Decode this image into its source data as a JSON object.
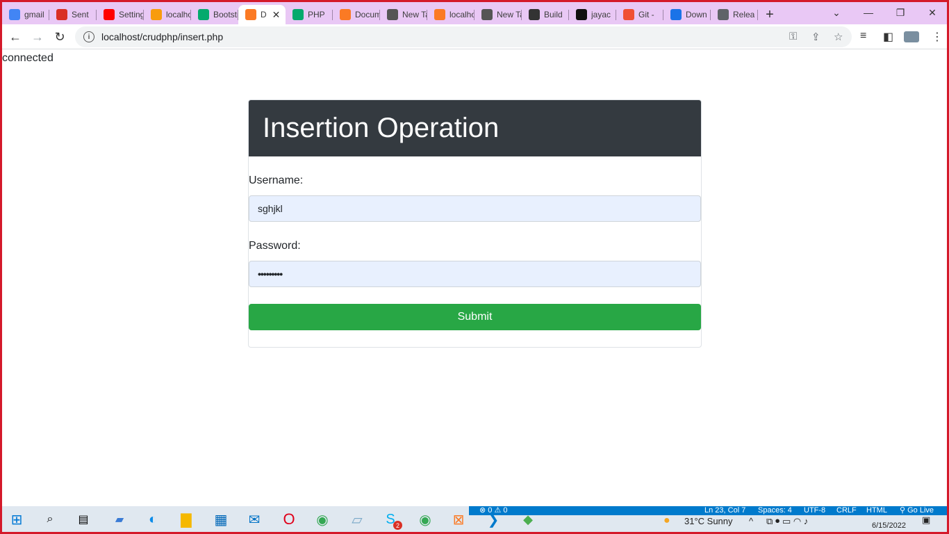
{
  "browser": {
    "tabs": [
      {
        "title": "gmail",
        "icon": "google-icon",
        "color": "#4285f4"
      },
      {
        "title": "Sent",
        "icon": "gmail-icon",
        "color": "#d93025"
      },
      {
        "title": "Settings",
        "icon": "youtube-icon",
        "color": "#ff0000"
      },
      {
        "title": "localhost",
        "icon": "phpmyadmin-icon",
        "color": "#f89c0e"
      },
      {
        "title": "Bootstrap",
        "icon": "w3schools-icon",
        "color": "#04aa6d"
      },
      {
        "title": "D",
        "icon": "xampp-icon",
        "color": "#fb7a24",
        "active": true
      },
      {
        "title": "PHP",
        "icon": "w3schools-icon",
        "color": "#04aa6d"
      },
      {
        "title": "Documentation",
        "icon": "xampp-icon",
        "color": "#fb7a24"
      },
      {
        "title": "New Tab",
        "icon": "chrome-icon",
        "color": "#555555"
      },
      {
        "title": "localhost",
        "icon": "xampp-icon",
        "color": "#fb7a24"
      },
      {
        "title": "New Tab",
        "icon": "chrome-icon",
        "color": "#555555"
      },
      {
        "title": "Build",
        "icon": "code-icon",
        "color": "#333333"
      },
      {
        "title": "jayac",
        "icon": "github-icon",
        "color": "#111111"
      },
      {
        "title": "Git -",
        "icon": "git-icon",
        "color": "#f05033"
      },
      {
        "title": "Down",
        "icon": "download-icon",
        "color": "#1a73e8"
      },
      {
        "title": "Relea",
        "icon": "globe-icon",
        "color": "#5f6368"
      }
    ],
    "url": "localhost/crudphp/insert.php"
  },
  "page": {
    "status": "connected",
    "card_title": "Insertion Operation",
    "username_label": "Username:",
    "username_value": "sghjkl",
    "password_label": "Password:",
    "password_value": "•••••••••",
    "submit_label": "Submit"
  },
  "colors": {
    "header_bg": "#343a40",
    "submit_bg": "#28a745",
    "autofill_bg": "#e8f0fe",
    "tabstrip_bg": "#e9c8f5"
  },
  "vscode_status": {
    "problems": "⊗ 0 ⚠ 0",
    "position": "Ln 23, Col 7",
    "spaces": "Spaces: 4",
    "encoding": "UTF-8",
    "eol": "CRLF",
    "language": "HTML",
    "golive": "Go Live"
  },
  "tray": {
    "weather": "31°C  Sunny",
    "date": "6/15/2022",
    "skype_badge": "2"
  }
}
